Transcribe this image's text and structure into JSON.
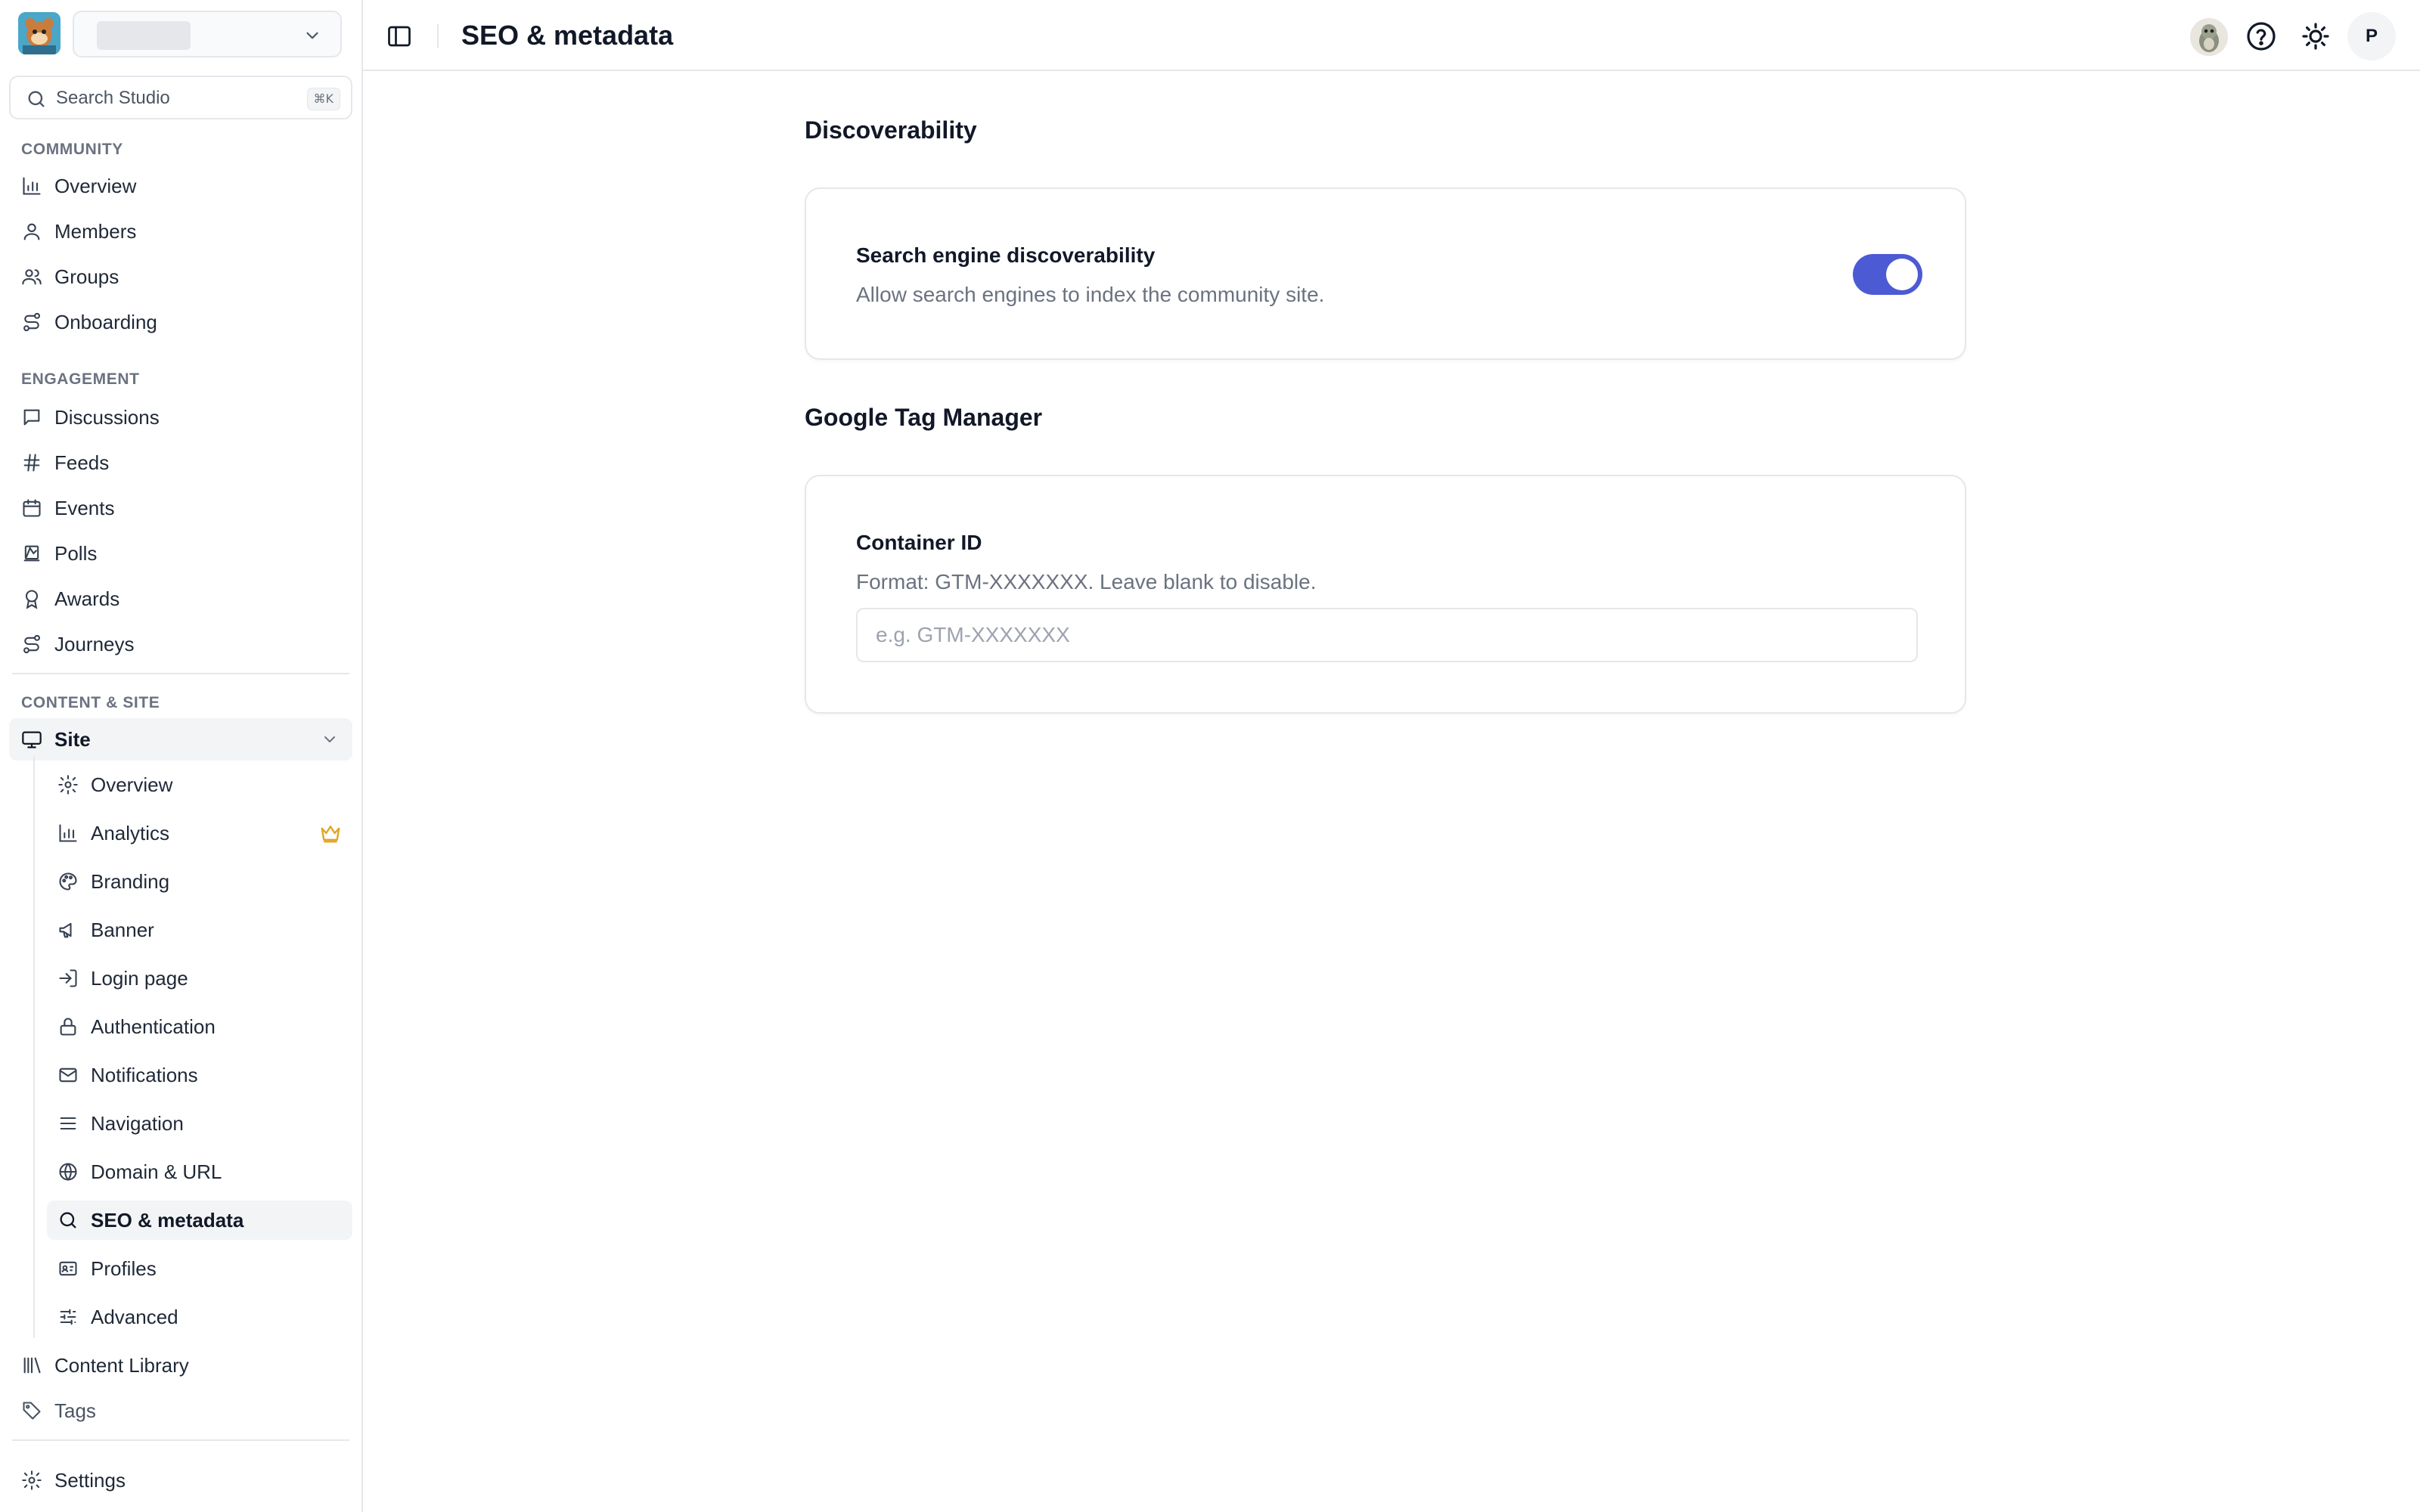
{
  "sidebar": {
    "search": {
      "placeholder": "Search Studio",
      "shortcut": "⌘K"
    },
    "sections": {
      "community": "COMMUNITY",
      "engagement": "ENGAGEMENT",
      "content_site": "CONTENT & SITE"
    },
    "community_items": [
      {
        "label": "Overview",
        "icon": "bar-chart-icon"
      },
      {
        "label": "Members",
        "icon": "user-icon"
      },
      {
        "label": "Groups",
        "icon": "users-icon"
      },
      {
        "label": "Onboarding",
        "icon": "route-icon"
      }
    ],
    "engagement_items": [
      {
        "label": "Discussions",
        "icon": "message-square-icon"
      },
      {
        "label": "Feeds",
        "icon": "hash-icon"
      },
      {
        "label": "Events",
        "icon": "calendar-icon"
      },
      {
        "label": "Polls",
        "icon": "poll-icon"
      },
      {
        "label": "Awards",
        "icon": "award-icon"
      },
      {
        "label": "Journeys",
        "icon": "route-icon"
      }
    ],
    "site": {
      "label": "Site",
      "icon": "monitor-icon",
      "expanded": true,
      "children": [
        {
          "label": "Overview",
          "icon": "gear-icon"
        },
        {
          "label": "Analytics",
          "icon": "bar-chart-icon",
          "badge": "crown-icon"
        },
        {
          "label": "Branding",
          "icon": "palette-icon"
        },
        {
          "label": "Banner",
          "icon": "megaphone-icon"
        },
        {
          "label": "Login page",
          "icon": "log-in-icon"
        },
        {
          "label": "Authentication",
          "icon": "lock-icon"
        },
        {
          "label": "Notifications",
          "icon": "mail-icon"
        },
        {
          "label": "Navigation",
          "icon": "menu-icon"
        },
        {
          "label": "Domain & URL",
          "icon": "globe-icon"
        },
        {
          "label": "SEO & metadata",
          "icon": "search-icon",
          "active": true
        },
        {
          "label": "Profiles",
          "icon": "id-card-icon"
        },
        {
          "label": "Advanced",
          "icon": "sliders-icon"
        }
      ]
    },
    "content_library": {
      "label": "Content Library",
      "icon": "library-icon"
    },
    "tags": {
      "label": "Tags",
      "icon": "tag-icon"
    },
    "settings": {
      "label": "Settings",
      "icon": "gear-icon"
    }
  },
  "topbar": {
    "title": "SEO & metadata",
    "avatar_initial": "P"
  },
  "main": {
    "discoverability": {
      "heading": "Discoverability",
      "setting_label": "Search engine discoverability",
      "setting_description": "Allow search engines to index the community site.",
      "enabled": true
    },
    "gtm": {
      "heading": "Google Tag Manager",
      "field_label": "Container ID",
      "field_help": "Format: GTM-XXXXXXX. Leave blank to disable.",
      "field_placeholder": "e.g. GTM-XXXXXXX",
      "field_value": ""
    }
  },
  "colors": {
    "accent": "#4c5bd4",
    "crown": "#e0a526",
    "border": "#e5e7eb",
    "muted_text": "#6b7280"
  }
}
